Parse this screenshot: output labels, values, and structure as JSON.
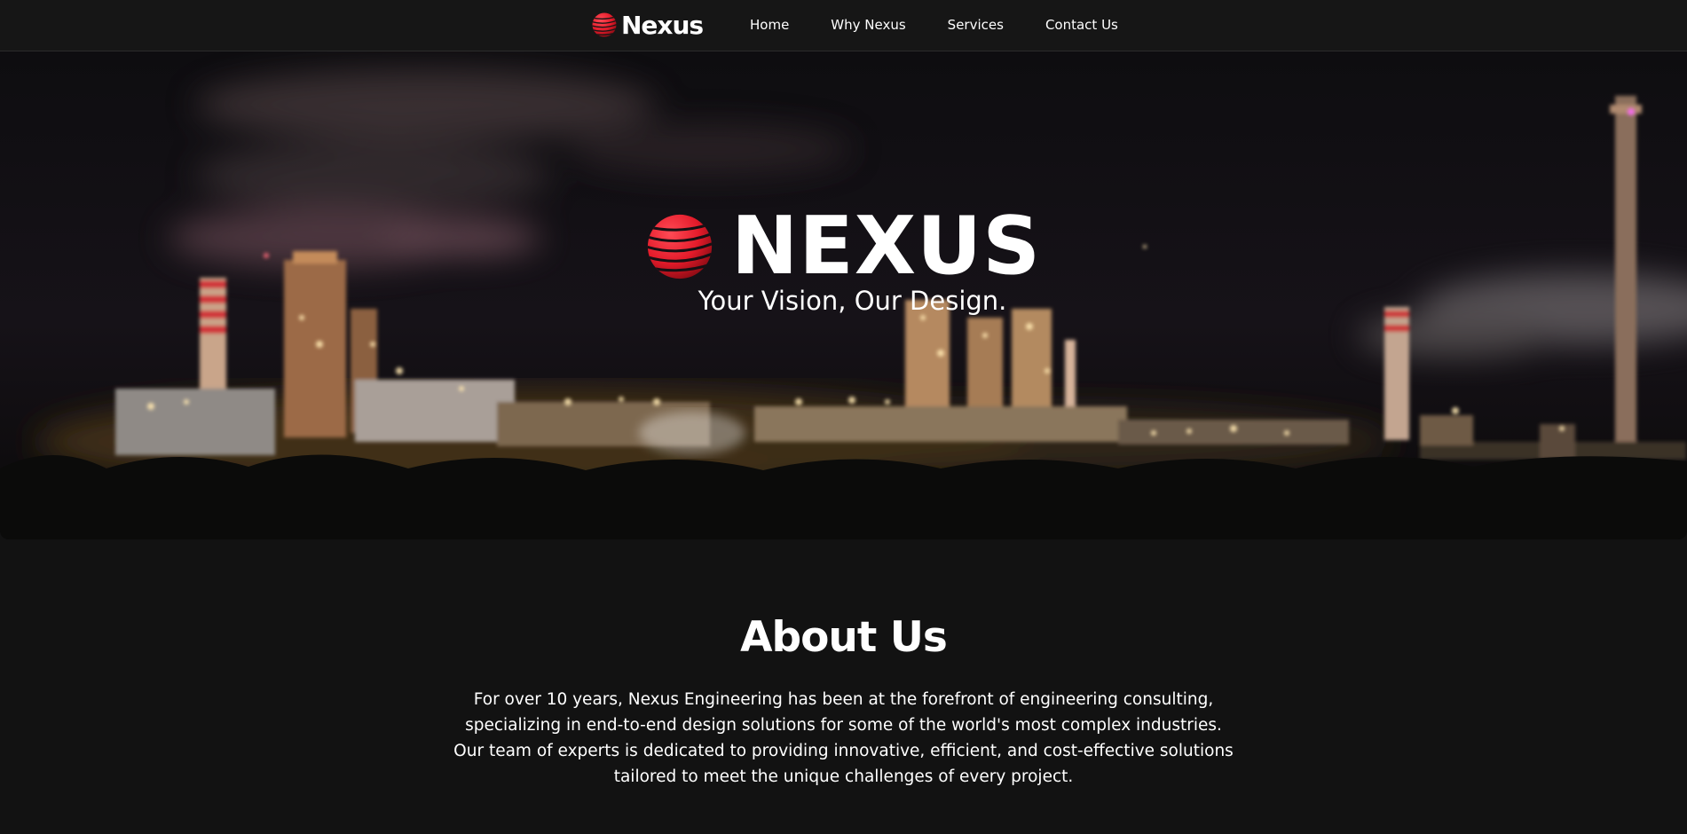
{
  "nav": {
    "brand": "Nexus",
    "links": [
      {
        "label": "Home"
      },
      {
        "label": "Why Nexus"
      },
      {
        "label": "Services"
      },
      {
        "label": "Contact Us"
      }
    ]
  },
  "hero": {
    "title": "NEXUS",
    "tagline": "Your Vision, Our Design."
  },
  "about": {
    "heading": "About Us",
    "body": "For over 10 years, Nexus Engineering has been at the forefront of engineering consulting, specializing in end-to-end design solutions for some of the world's most complex industries. Our team of experts is dedicated to providing innovative, efficient, and cost-effective solutions tailored to meet the unique challenges of every project."
  },
  "icons": {
    "logo": "striped-globe-icon"
  },
  "colors": {
    "background": "#121212",
    "navbar": "#161616",
    "accent_red": "#e31b2a",
    "text": "#ffffff"
  }
}
